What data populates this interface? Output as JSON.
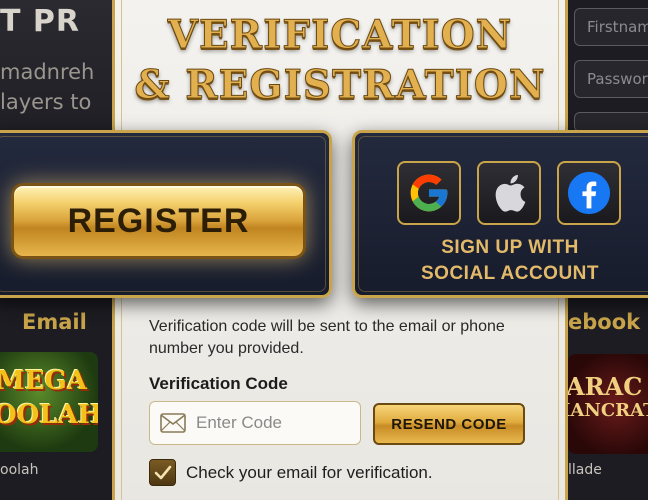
{
  "background_left": {
    "promo_title": "T PR",
    "promo_line1": "madnreh",
    "promo_line2": "layers to",
    "tab_label": "Email",
    "game_logo_line1": "MEGA",
    "game_logo_line2": "OOLAH",
    "game_caption": "oolah"
  },
  "background_right": {
    "firstname_placeholder": "Firstnam",
    "password_placeholder": "Passwor",
    "tab_label": "ebook",
    "game_logo_line1": "ARAC",
    "game_logo_line2": "IANCRAT",
    "game_caption": "llade"
  },
  "modal": {
    "title_line1": "VERIFICATION",
    "title_line2": "& REGISTRATION",
    "info_text": "Verification code will be sent to the email or phone number you provided.",
    "code_label": "Verification Code",
    "code_placeholder": "Enter Code",
    "resend_label": "RESEND CODE",
    "checkbox_label": "Check your email for verification.",
    "checkbox_checked": true
  },
  "register_card": {
    "button_label": "REGISTER"
  },
  "social_card": {
    "providers": [
      "google-icon",
      "apple-icon",
      "facebook-icon"
    ],
    "label_line1": "SIGN UP WITH",
    "label_line2": "SOCIAL ACCOUNT"
  },
  "colors": {
    "gold": "#c9a44a",
    "card_navy": "#1d2234",
    "facebook_blue": "#1877f2"
  }
}
